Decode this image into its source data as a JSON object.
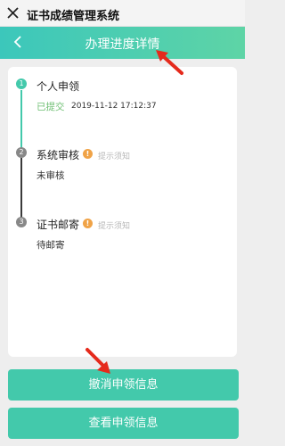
{
  "app": {
    "title": "证书成绩管理系统"
  },
  "header": {
    "title": "办理进度详情"
  },
  "steps": [
    {
      "num": "1",
      "title": "个人申领",
      "status": "已提交",
      "time": "2019-11-12 17:12:37"
    },
    {
      "num": "2",
      "title": "系统审核",
      "status": "未审核",
      "tip": "提示须知"
    },
    {
      "num": "3",
      "title": "证书邮寄",
      "status": "待邮寄",
      "tip": "提示须知"
    }
  ],
  "buttons": {
    "revoke": "撤消申领信息",
    "view": "查看申领信息"
  },
  "colors": {
    "accent": "#43c9ab",
    "header_start": "#3cc7bb",
    "header_end": "#5ed4a6",
    "submitted": "#6fbf73",
    "info": "#f0a347",
    "annotation_arrow": "#e52a1c"
  }
}
